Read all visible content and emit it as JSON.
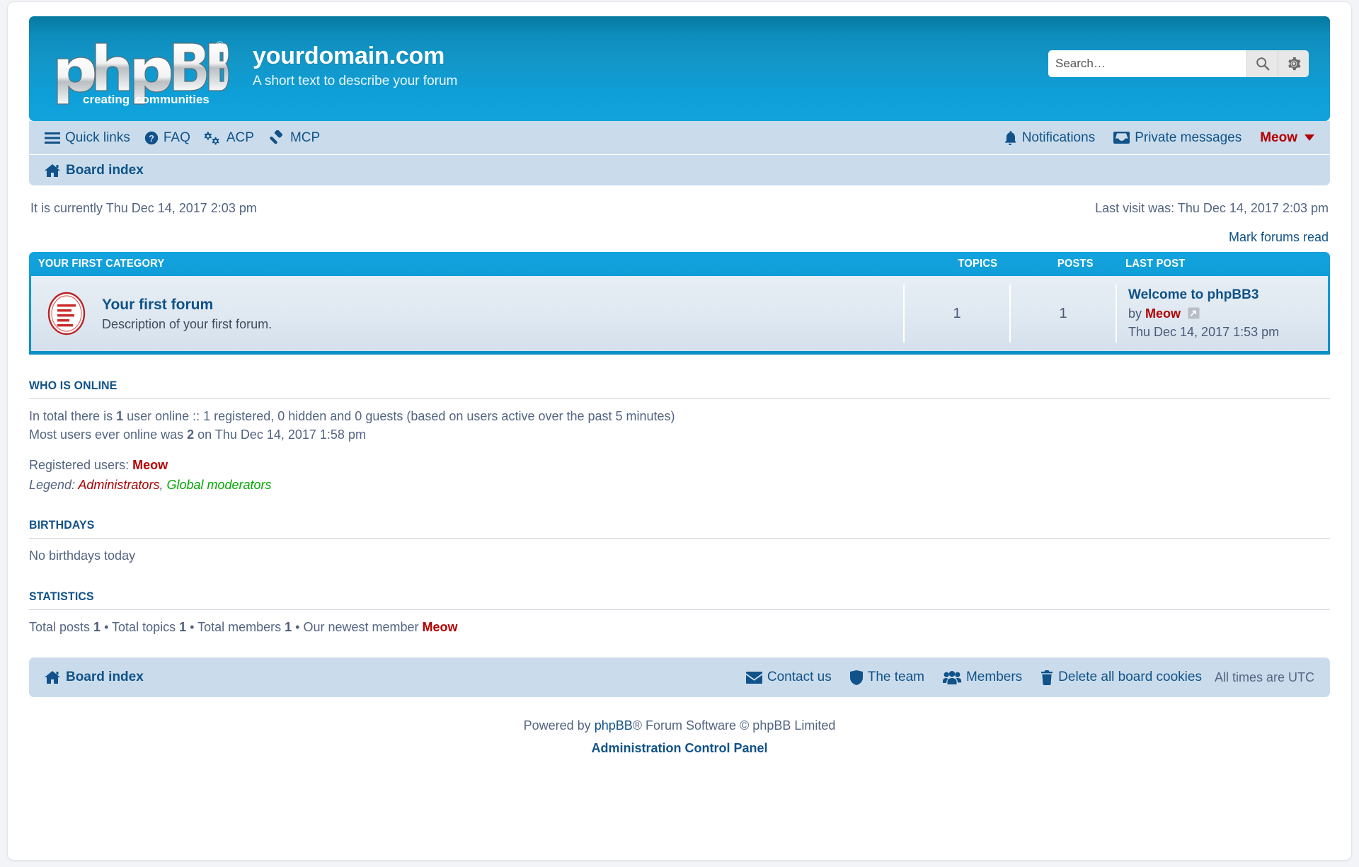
{
  "header": {
    "logo_text_main": "phpBB",
    "logo_text_sub_left": "creating",
    "logo_text_sub_right": "communities",
    "logo_reg_mark": "®",
    "site_title": "yourdomain.com",
    "site_description": "A short text to describe your forum",
    "search": {
      "placeholder": "Search…",
      "value": "",
      "search_icon": "search-icon",
      "advanced_icon": "gear-icon"
    }
  },
  "nav": {
    "left": [
      {
        "label": "Quick links",
        "icon": "hamburger-icon"
      },
      {
        "label": "FAQ",
        "icon": "question-circle-icon"
      },
      {
        "label": "ACP",
        "icon": "cogs-icon"
      },
      {
        "label": "MCP",
        "icon": "gavel-icon"
      }
    ],
    "right": [
      {
        "label": "Notifications",
        "icon": "bell-icon"
      },
      {
        "label": "Private messages",
        "icon": "inbox-icon"
      }
    ],
    "username": "Meow"
  },
  "breadcrumb": {
    "label": "Board index",
    "icon": "home-icon"
  },
  "time": {
    "current": "It is currently Thu Dec 14, 2017 2:03 pm",
    "last_visit": "Last visit was: Thu Dec 14, 2017 2:03 pm"
  },
  "mark_forums_read": "Mark forums read",
  "forum_table": {
    "category": "Your first category",
    "columns": {
      "topics": "Topics",
      "posts": "Posts",
      "lastpost": "Last post"
    },
    "rows": [
      {
        "name": "Your first forum",
        "description": "Description of your first forum.",
        "topics": "1",
        "posts": "1",
        "lastpost_title": "Welcome to phpBB3",
        "lastpost_by_label": "by",
        "lastpost_author": "Meow",
        "lastpost_date": "Thu Dec 14, 2017 1:53 pm"
      }
    ]
  },
  "who_is_online": {
    "title": "Who is online",
    "line1_pre": "In total there is ",
    "line1_count": "1",
    "line1_post": " user online :: 1 registered, 0 hidden and 0 guests (based on users active over the past 5 minutes)",
    "line2_pre": "Most users ever online was ",
    "line2_count": "2",
    "line2_post": " on Thu Dec 14, 2017 1:58 pm",
    "registered_label": "Registered users: ",
    "registered_users": "Meow",
    "legend_label": "Legend: ",
    "legend_admins": "Administrators",
    "legend_separator": ", ",
    "legend_mods": "Global moderators"
  },
  "birthdays": {
    "title": "Birthdays",
    "text": "No birthdays today"
  },
  "statistics": {
    "title": "Statistics",
    "total_posts_label": "Total posts ",
    "total_posts": "1",
    "sep1": " • ",
    "total_topics_label": "Total topics ",
    "total_topics": "1",
    "sep2": " • ",
    "total_members_label": "Total members ",
    "total_members": "1",
    "sep3": " • ",
    "newest_member_label": "Our newest member ",
    "newest_member": "Meow"
  },
  "footer": {
    "board_index": "Board index",
    "links": [
      {
        "label": "Contact us",
        "icon": "envelope-icon"
      },
      {
        "label": "The team",
        "icon": "shield-icon"
      },
      {
        "label": "Members",
        "icon": "users-icon"
      },
      {
        "label": "Delete all board cookies",
        "icon": "trash-icon"
      }
    ],
    "timezone": "All times are UTC",
    "copyright_pre": "Powered by ",
    "copyright_link": "phpBB",
    "copyright_post": "® Forum Software © phpBB Limited",
    "acp_link": "Administration Control Panel"
  },
  "colors": {
    "header_blue": "#0d8dbc",
    "nav_blue": "#cadceb",
    "link_blue": "#105289",
    "accent_red": "#b40000",
    "mod_green": "#00aa00",
    "cat_header_blue": "#12a3de"
  }
}
